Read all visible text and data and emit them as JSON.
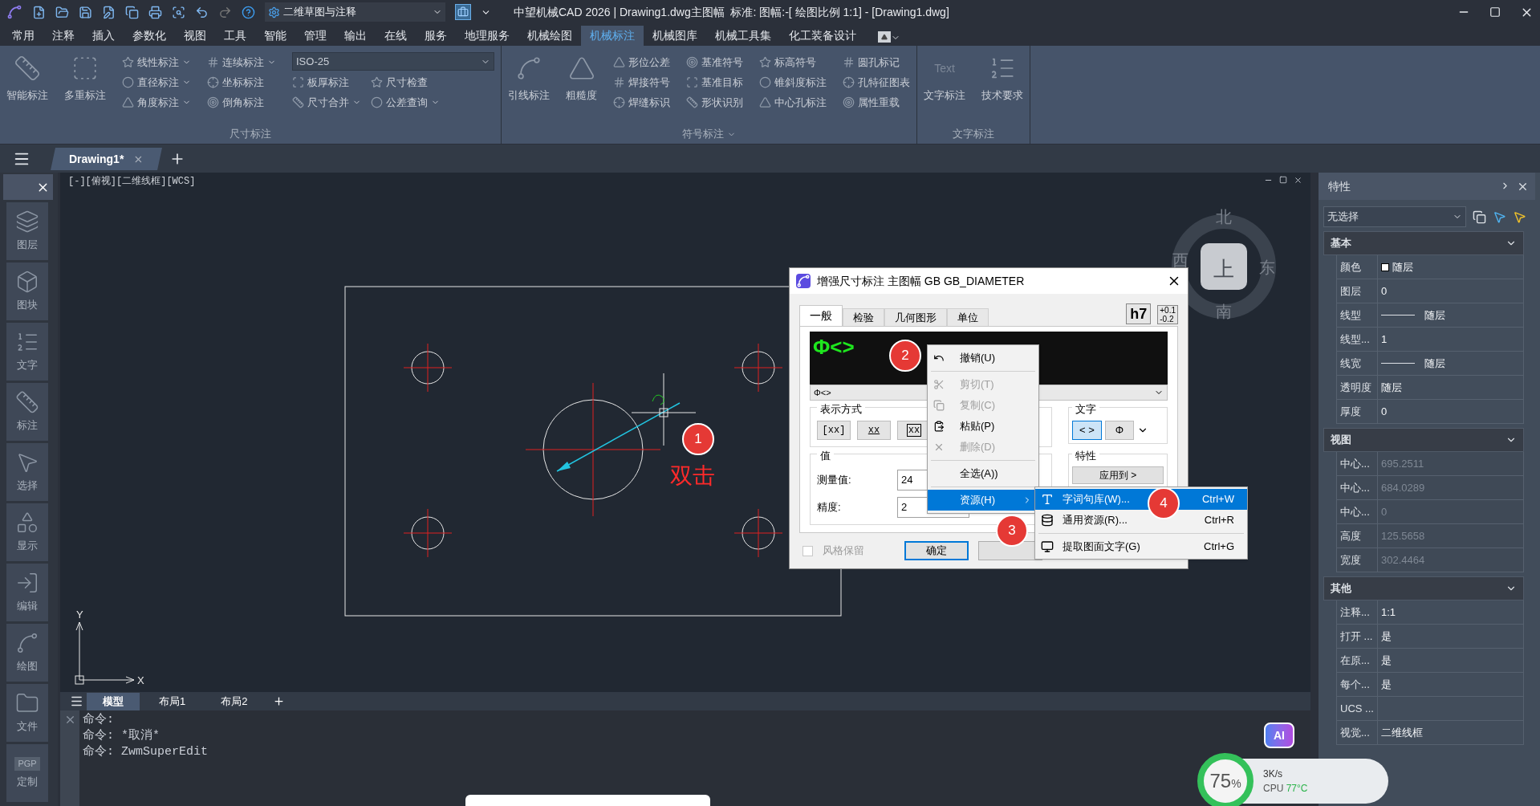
{
  "title_bar": {
    "workspace": "二维草图与注释",
    "title": "中望机械CAD 2026 | Drawing1.dwg主图幅  标准: 图幅:-[ 绘图比例 1:1] - [Drawing1.dwg]"
  },
  "menu_tabs": [
    {
      "label": "常用",
      "selected": false
    },
    {
      "label": "注释",
      "selected": false
    },
    {
      "label": "插入",
      "selected": false
    },
    {
      "label": "参数化",
      "selected": false
    },
    {
      "label": "视图",
      "selected": false
    },
    {
      "label": "工具",
      "selected": false
    },
    {
      "label": "智能",
      "selected": false
    },
    {
      "label": "管理",
      "selected": false
    },
    {
      "label": "输出",
      "selected": false
    },
    {
      "label": "在线",
      "selected": false
    },
    {
      "label": "服务",
      "selected": false
    },
    {
      "label": "地理服务",
      "selected": false
    },
    {
      "label": "机械绘图",
      "selected": false
    },
    {
      "label": "机械标注",
      "selected": true
    },
    {
      "label": "机械图库",
      "selected": false
    },
    {
      "label": "机械工具集",
      "selected": false
    },
    {
      "label": "化工装备设计",
      "selected": false
    }
  ],
  "ribbon_groups": [
    {
      "label": "尺寸标注",
      "dropdown": false,
      "blocks": [
        {
          "kind": "large",
          "label": "智能标注"
        },
        {
          "kind": "large",
          "label": "多重标注"
        },
        {
          "kind": "column",
          "items": [
            {
              "label": "线性标注",
              "dropdown": true
            },
            {
              "label": "直径标注",
              "dropdown": true
            },
            {
              "label": "角度标注",
              "dropdown": true
            }
          ]
        },
        {
          "kind": "column",
          "items": [
            {
              "label": "连续标注",
              "dropdown": true
            },
            {
              "label": "坐标标注",
              "dropdown": false
            },
            {
              "label": "倒角标注",
              "dropdown": false
            }
          ]
        },
        {
          "kind": "combo",
          "value": "ISO-25",
          "columns": [
            [
              {
                "label": "板厚标注",
                "dropdown": false
              },
              {
                "label": "尺寸合并",
                "dropdown": true
              }
            ],
            [
              {
                "label": "尺寸检查",
                "dropdown": false
              },
              {
                "label": "公差查询",
                "dropdown": true
              }
            ]
          ]
        }
      ]
    },
    {
      "label": "符号标注",
      "dropdown": true,
      "blocks": [
        {
          "kind": "large",
          "label": "引线标注"
        },
        {
          "kind": "large",
          "label": "粗糙度"
        },
        {
          "kind": "column",
          "items": [
            {
              "label": "形位公差",
              "dropdown": false
            },
            {
              "label": "焊接符号",
              "dropdown": false
            },
            {
              "label": "焊缝标识",
              "dropdown": false
            }
          ]
        },
        {
          "kind": "column",
          "items": [
            {
              "label": "基准符号",
              "dropdown": false
            },
            {
              "label": "基准目标",
              "dropdown": false
            },
            {
              "label": "形状识别",
              "dropdown": false
            }
          ]
        },
        {
          "kind": "column",
          "items": [
            {
              "label": "标高符号",
              "dropdown": false
            },
            {
              "label": "锥斜度标注",
              "dropdown": false
            },
            {
              "label": "中心孔标注",
              "dropdown": false
            }
          ]
        },
        {
          "kind": "column",
          "items": [
            {
              "label": "圆孔标记",
              "dropdown": false
            },
            {
              "label": "孔特征图表",
              "dropdown": false
            },
            {
              "label": "属性重载",
              "dropdown": false
            }
          ]
        }
      ]
    },
    {
      "label": "文字标注",
      "dropdown": false,
      "blocks": [
        {
          "kind": "large",
          "label": "文字标注",
          "icon_text": "Text"
        },
        {
          "kind": "large",
          "label": "技术要求"
        }
      ]
    }
  ],
  "doc_tabs": [
    {
      "label": "Drawing1*",
      "selected": true
    }
  ],
  "viewport": {
    "label": "[-][俯视][二维线框][WCS]",
    "axis_x": "X",
    "axis_y": "Y",
    "compass": {
      "north": "北",
      "east": "东",
      "south": "南",
      "west": "西",
      "top": "上"
    }
  },
  "sidebar": {
    "items": [
      {
        "label": "图层"
      },
      {
        "label": "图块"
      },
      {
        "label": "文字"
      },
      {
        "label": "标注"
      },
      {
        "label": "选择"
      },
      {
        "label": "显示"
      },
      {
        "label": "编辑"
      },
      {
        "label": "绘图"
      },
      {
        "label": "文件"
      },
      {
        "label": "定制",
        "icon_text": "PGP"
      }
    ]
  },
  "annotations": [
    {
      "label": "1"
    },
    {
      "label": "2"
    },
    {
      "label": "3"
    },
    {
      "label": "4"
    }
  ],
  "annotation_note": "双击",
  "dialog": {
    "title": "增强尺寸标注 主图幅 GB GB_DIAMETER",
    "tabs": [
      {
        "label": "一般",
        "selected": true
      },
      {
        "label": "检验",
        "selected": false
      },
      {
        "label": "几何图形",
        "selected": false
      },
      {
        "label": "单位",
        "selected": false
      }
    ],
    "fit_badge": "h7",
    "tolerance_upper": "+0.1",
    "tolerance_lower": "-0.2",
    "preview_text": "Φ<>",
    "text_combo": "Φ<>",
    "display_group": {
      "label": "表示方式",
      "buttons": [
        "[xx]",
        "xx",
        "xx"
      ]
    },
    "value_group": {
      "label": "值",
      "fields": [
        {
          "label": "测量值:",
          "value": "24"
        },
        {
          "label": "精度:",
          "value": "2"
        }
      ]
    },
    "text_group": {
      "label": "文字",
      "buttons": [
        {
          "label": "< >",
          "selected": true
        },
        {
          "label": "Φ",
          "selected": false
        }
      ]
    },
    "property_group": {
      "label": "特性",
      "button": "应用到 >"
    },
    "keep_style": {
      "label": "风格保留",
      "checked": false
    },
    "ok_button": "确定"
  },
  "context_menu": {
    "items": [
      {
        "kind": "item",
        "label": "撤销(U)",
        "disabled": false,
        "selected": false
      },
      {
        "kind": "separator"
      },
      {
        "kind": "item",
        "label": "剪切(T)",
        "disabled": true,
        "selected": false
      },
      {
        "kind": "item",
        "label": "复制(C)",
        "disabled": true,
        "selected": false
      },
      {
        "kind": "item",
        "label": "粘贴(P)",
        "disabled": false,
        "selected": false
      },
      {
        "kind": "item",
        "label": "删除(D)",
        "disabled": true,
        "selected": false
      },
      {
        "kind": "separator"
      },
      {
        "kind": "item",
        "label": "全选(A))",
        "disabled": false,
        "selected": false
      },
      {
        "kind": "separator"
      },
      {
        "kind": "submenu",
        "label": "资源(H)",
        "disabled": false,
        "selected": true
      }
    ]
  },
  "submenu": {
    "items": [
      {
        "kind": "item",
        "label": "字词句库(W)...",
        "shortcut": "Ctrl+W",
        "selected": true
      },
      {
        "kind": "item",
        "label": "通用资源(R)...",
        "shortcut": "Ctrl+R",
        "selected": false
      },
      {
        "kind": "separator"
      },
      {
        "kind": "item",
        "label": "提取图面文字(G)",
        "shortcut": "Ctrl+G",
        "selected": false
      }
    ]
  },
  "properties": {
    "title": "特性",
    "selection": "无选择",
    "sections": [
      {
        "label": "基本",
        "rows": [
          {
            "kind": "swatch",
            "label": "颜色",
            "value": "随层",
            "disabled": false
          },
          {
            "kind": "text",
            "label": "图层",
            "value": "0",
            "disabled": false
          },
          {
            "kind": "line",
            "label": "线型",
            "value": "随层",
            "disabled": false
          },
          {
            "kind": "text",
            "label": "线型...",
            "value": "1",
            "disabled": false
          },
          {
            "kind": "line",
            "label": "线宽",
            "value": "随层",
            "disabled": false
          },
          {
            "kind": "text",
            "label": "透明度",
            "value": "随层",
            "disabled": false
          },
          {
            "kind": "text",
            "label": "厚度",
            "value": "0",
            "disabled": false
          }
        ]
      },
      {
        "label": "视图",
        "rows": [
          {
            "kind": "text",
            "label": "中心...",
            "value": "695.2511",
            "disabled": true
          },
          {
            "kind": "text",
            "label": "中心...",
            "value": "684.0289",
            "disabled": true
          },
          {
            "kind": "text",
            "label": "中心...",
            "value": "0",
            "disabled": true
          },
          {
            "kind": "text",
            "label": "高度",
            "value": "125.5658",
            "disabled": true
          },
          {
            "kind": "text",
            "label": "宽度",
            "value": "302.4464",
            "disabled": true
          }
        ]
      },
      {
        "label": "其他",
        "rows": [
          {
            "kind": "text",
            "label": "注释...",
            "value": "1:1",
            "disabled": false
          },
          {
            "kind": "text",
            "label": "打开 ...",
            "value": "是",
            "disabled": false
          },
          {
            "kind": "text",
            "label": "在原...",
            "value": "是",
            "disabled": false
          },
          {
            "kind": "text",
            "label": "每个...",
            "value": "是",
            "disabled": false
          },
          {
            "kind": "text",
            "label": "UCS ..."
          },
          {
            "kind": "text",
            "label": "视觉...",
            "value": "二维线框",
            "disabled": false
          }
        ]
      }
    ]
  },
  "layout_tabs": [
    {
      "label": "模型",
      "selected": true
    },
    {
      "label": "布局1",
      "selected": false
    },
    {
      "label": "布局2",
      "selected": false
    }
  ],
  "command_lines": [
    "命令:",
    "命令: *取消*",
    "命令: ZwmSuperEdit"
  ],
  "ai_button": "AI",
  "monitor": {
    "load": "75",
    "unit": "%",
    "speed": "3K/s",
    "cpu_label": "CPU",
    "cpu_temp": "77°C"
  }
}
